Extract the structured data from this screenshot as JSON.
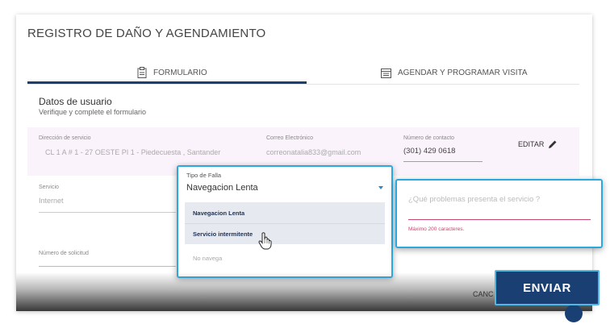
{
  "page": {
    "title": "REGISTRO DE DAÑO Y AGENDAMIENTO"
  },
  "tabs": [
    {
      "label": "FORMULARIO",
      "icon": "clipboard-icon",
      "active": true
    },
    {
      "label": "AGENDAR Y PROGRAMAR VISITA",
      "icon": "calendar-icon",
      "active": false
    }
  ],
  "section": {
    "title": "Datos de usuario",
    "subtitle": "Verifique y complete el formulario"
  },
  "user": {
    "address_label": "Dirección de servicio",
    "address_value": "CL 1 A # 1 - 27 OESTE PI 1 - Piedecuesta , Santander",
    "email_label": "Correo Electrónico",
    "email_value": "correonatalia833@gmail.com",
    "phone_label": "Número de contacto",
    "phone_value": "(301) 429 0618",
    "edit_label": "EDITAR"
  },
  "service": {
    "label": "Servicio",
    "value": "Internet"
  },
  "request": {
    "label": "Número de solicitud"
  },
  "fault": {
    "label": "Tipo de Falla",
    "selected": "Navegacion Lenta",
    "options": [
      "Navegacion Lenta",
      "Servicio intermitente",
      "No navega"
    ]
  },
  "problem": {
    "placeholder": "¿Qué problemas presenta el servicio ?",
    "helper": "Máximo 200 caracteres."
  },
  "actions": {
    "cancel_label": "CANC",
    "send_label": "ENVIAR"
  },
  "colors": {
    "primary": "#1a3f73",
    "accent": "#29a9e0",
    "error": "#c8476e",
    "highlight_bg": "#fbf3fb"
  }
}
